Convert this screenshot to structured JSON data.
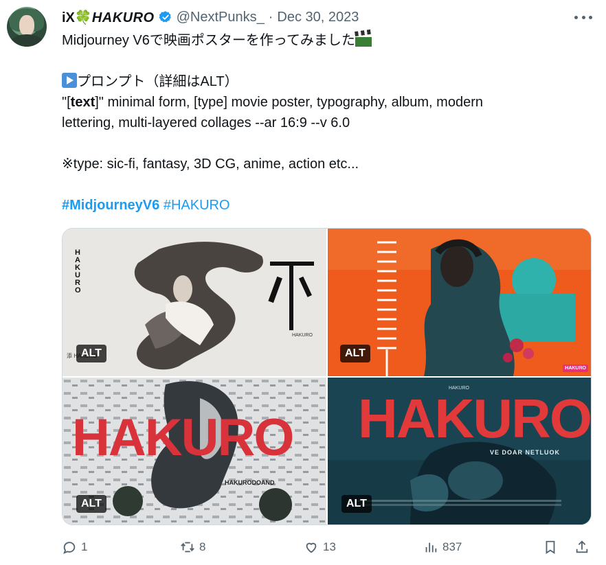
{
  "author": {
    "name_prefix": "iX",
    "name_emoji": "🍀",
    "name_suffix": "HAKURO",
    "handle": "@NextPunks_",
    "separator": "·",
    "date": "Dec 30, 2023"
  },
  "tweet": {
    "line1": "Midjourney V6で映画ポスターを作ってみました",
    "prompt_label": "プロンプト（詳細はALT）",
    "line3_quote_open": "\"[",
    "line3_bold": "text",
    "line3_rest": "]\" minimal form, [type] movie poster, typography, album, modern",
    "line4": "lettering, multi-layered collages --ar 16:9 --v 6.0",
    "line5": "※type: sic-fi, fantasy, 3D CG, anime, action etc...",
    "hashtag1": "#MidjourneyV6",
    "hashtag2": " #HAKURO"
  },
  "media": {
    "alt_label": "ALT",
    "tile1": {
      "vertical_text": "HAKURO",
      "kanji": "不",
      "bottom_left": "添 HAKURO",
      "small": "HAKURO"
    },
    "tile2": {
      "badge": "HAKURO"
    },
    "tile3": {
      "title": "HAKURO",
      "small": "HAKURODOAND"
    },
    "tile4": {
      "title": "HAKURO",
      "top": "HAKURO",
      "sub": "VE DOAR NETLUOK"
    }
  },
  "actions": {
    "replies": "1",
    "reposts": "8",
    "likes": "13",
    "views": "837"
  },
  "colors": {
    "accent": "#1d9bf0",
    "muted": "#536471",
    "text": "#0f1419"
  }
}
